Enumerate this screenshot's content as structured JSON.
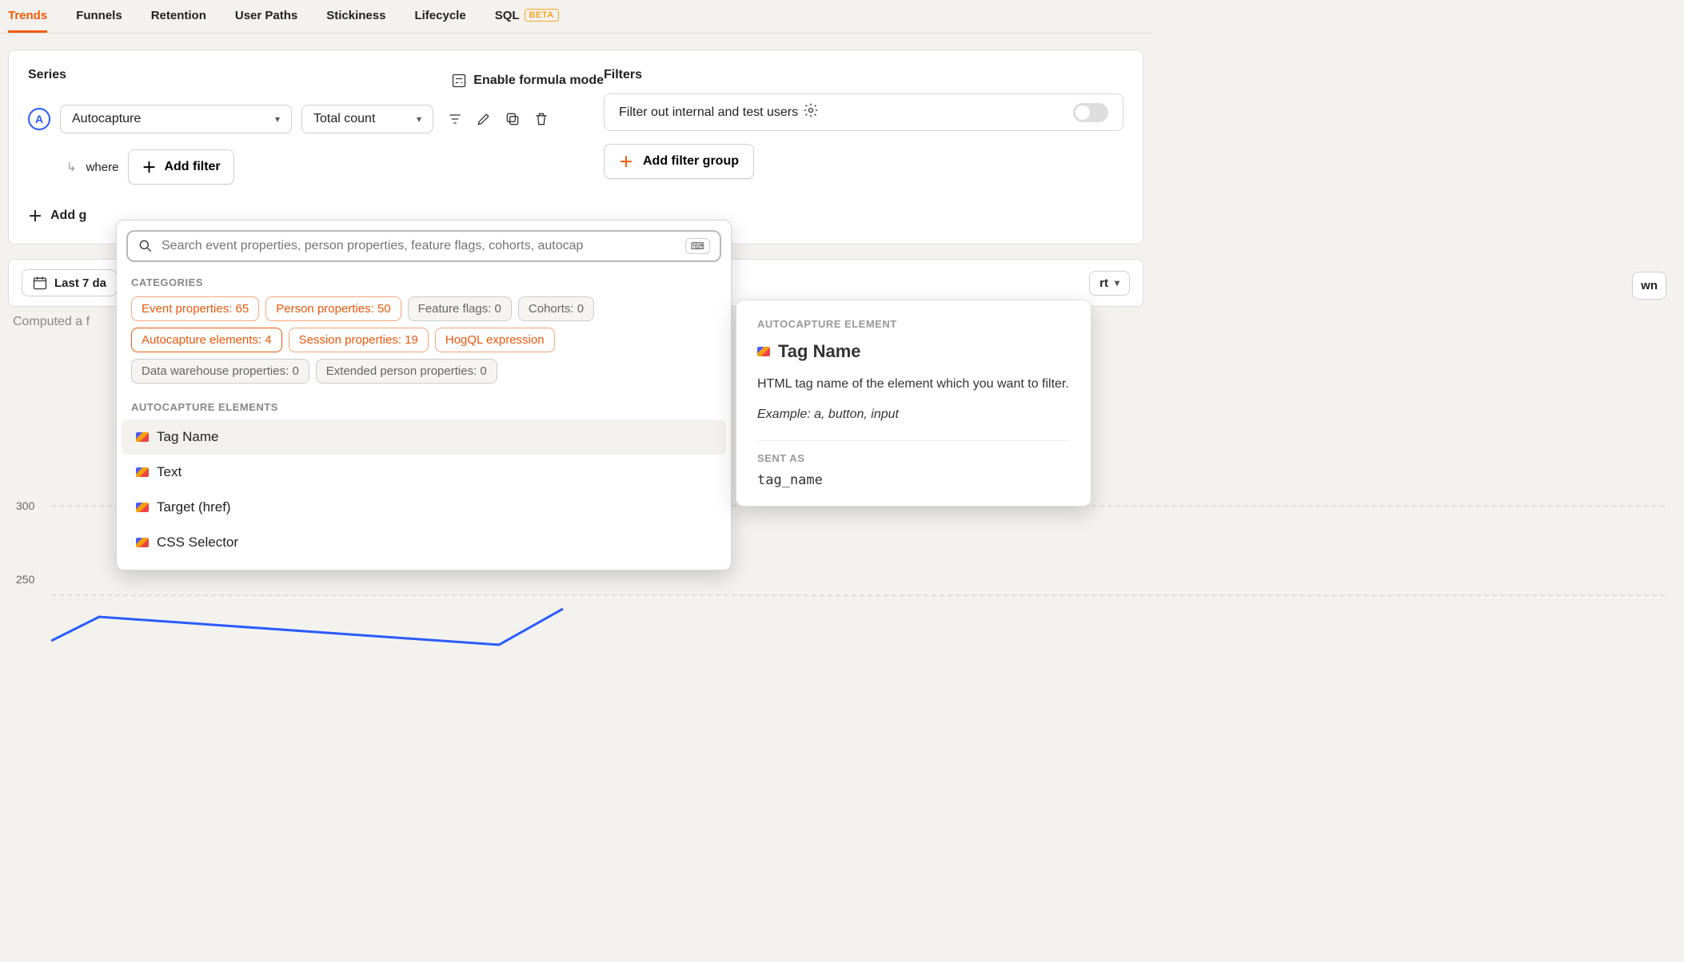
{
  "tabs": {
    "trends": "Trends",
    "funnels": "Funnels",
    "retention": "Retention",
    "userpaths": "User Paths",
    "stickiness": "Stickiness",
    "lifecycle": "Lifecycle",
    "sql": "SQL",
    "beta": "BETA"
  },
  "series": {
    "title": "Series",
    "formula_label": "Enable formula mode",
    "badge": "A",
    "event": "Autocapture",
    "aggregation": "Total count",
    "where": "where",
    "add_filter": "Add filter",
    "add_graph": "Add g"
  },
  "filters": {
    "title": "Filters",
    "internal_text": "Filter out internal and test users",
    "add_filter_group": "Add filter group"
  },
  "breakdown_peek": "wn",
  "popover": {
    "placeholder": "Search event properties, person properties, feature flags, cohorts, autocap",
    "categories_label": "CATEGORIES",
    "chips": {
      "event_props": "Event properties: 65",
      "person_props": "Person properties: 50",
      "feature_flags": "Feature flags: 0",
      "cohorts": "Cohorts: 0",
      "autocap": "Autocapture elements: 4",
      "session_props": "Session properties: 19",
      "hogql": "HogQL expression",
      "dw_props": "Data warehouse properties: 0",
      "ext_person": "Extended person properties: 0"
    },
    "section_label": "AUTOCAPTURE ELEMENTS",
    "options": {
      "tagname": "Tag Name",
      "text": "Text",
      "href": "Target (href)",
      "css": "CSS Selector"
    }
  },
  "tooltip": {
    "eyebrow": "AUTOCAPTURE ELEMENT",
    "title": "Tag Name",
    "desc": "HTML tag name of the element which you want to filter.",
    "example": "Example: a, button, input",
    "sent_as_label": "SENT AS",
    "sent_as_value": "tag_name"
  },
  "daterange": {
    "label": "Last 7 da",
    "rt": "rt"
  },
  "computed": "Computed a f",
  "yaxis": {
    "a": "300",
    "b": "250"
  }
}
